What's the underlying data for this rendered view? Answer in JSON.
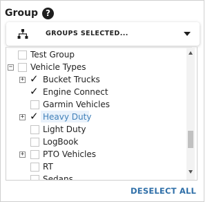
{
  "header": {
    "title": "Group",
    "help_icon": "question-circle-icon",
    "help_glyph": "?"
  },
  "dropdown": {
    "label": "GROUPS SELECTED...",
    "icon": "hierarchy-icon",
    "caret": "chevron-down-icon"
  },
  "tree": {
    "items": [
      {
        "label": "Test Group",
        "checked": false,
        "expander": null,
        "level": 1,
        "highlighted": false
      },
      {
        "label": "Vehicle Types",
        "checked": false,
        "expander": "−",
        "level": 1,
        "highlighted": false
      },
      {
        "label": "Bucket Trucks",
        "checked": true,
        "expander": "+",
        "level": 2,
        "highlighted": false
      },
      {
        "label": "Engine Connect",
        "checked": true,
        "expander": null,
        "level": 2,
        "highlighted": false
      },
      {
        "label": "Garmin Vehicles",
        "checked": false,
        "expander": null,
        "level": 2,
        "highlighted": false
      },
      {
        "label": "Heavy Duty",
        "checked": true,
        "expander": "+",
        "level": 2,
        "highlighted": true
      },
      {
        "label": "Light Duty",
        "checked": false,
        "expander": null,
        "level": 2,
        "highlighted": false
      },
      {
        "label": "LogBook",
        "checked": false,
        "expander": null,
        "level": 2,
        "highlighted": false
      },
      {
        "label": "PTO Vehicles",
        "checked": false,
        "expander": "+",
        "level": 2,
        "highlighted": false
      },
      {
        "label": "RT",
        "checked": false,
        "expander": null,
        "level": 2,
        "highlighted": false
      },
      {
        "label": "Sedans",
        "checked": false,
        "expander": null,
        "level": 2,
        "highlighted": false
      }
    ]
  },
  "footer": {
    "deselect_label": "DESELECT ALL"
  },
  "colors": {
    "accent": "#2f6fa8",
    "highlight_text": "#3f7fb8",
    "highlight_bg": "#e9f2fb"
  },
  "check_glyph": "✓"
}
